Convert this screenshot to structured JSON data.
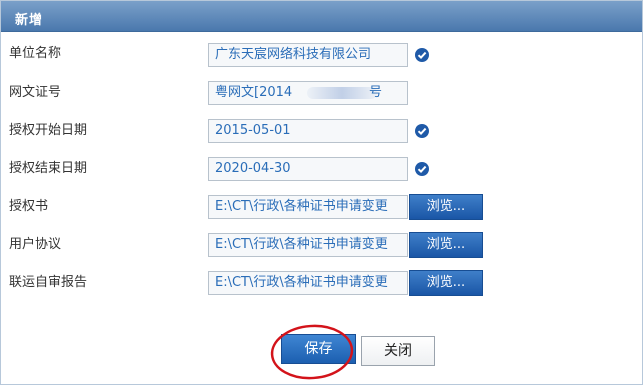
{
  "header": {
    "title": "新增"
  },
  "form": {
    "rows": [
      {
        "label": "单位名称",
        "value": "广东天宸网络科技有限公司",
        "type": "text",
        "check": true
      },
      {
        "label": "网文证号",
        "value": "粤网文[2014",
        "suffix": "号",
        "type": "text",
        "check": false
      },
      {
        "label": "授权开始日期",
        "value": "2015-05-01",
        "type": "date",
        "check": true
      },
      {
        "label": "授权结束日期",
        "value": "2020-04-30",
        "type": "date",
        "check": true
      },
      {
        "label": "授权书",
        "value": "E:\\CT\\行政\\各种证书申请变更",
        "type": "file",
        "browse": "浏览..."
      },
      {
        "label": "用户协议",
        "value": "E:\\CT\\行政\\各种证书申请变更",
        "type": "file",
        "browse": "浏览..."
      },
      {
        "label": "联运自审报告",
        "value": "E:\\CT\\行政\\各种证书申请变更",
        "type": "file",
        "browse": "浏览..."
      }
    ]
  },
  "actions": {
    "save_label": "保存",
    "close_label": "关闭"
  },
  "colors": {
    "header": "#4a78ad",
    "accent": "#1f5aa8",
    "annotation": "#d3131a"
  },
  "icons": {
    "check": "check-circle-icon"
  }
}
